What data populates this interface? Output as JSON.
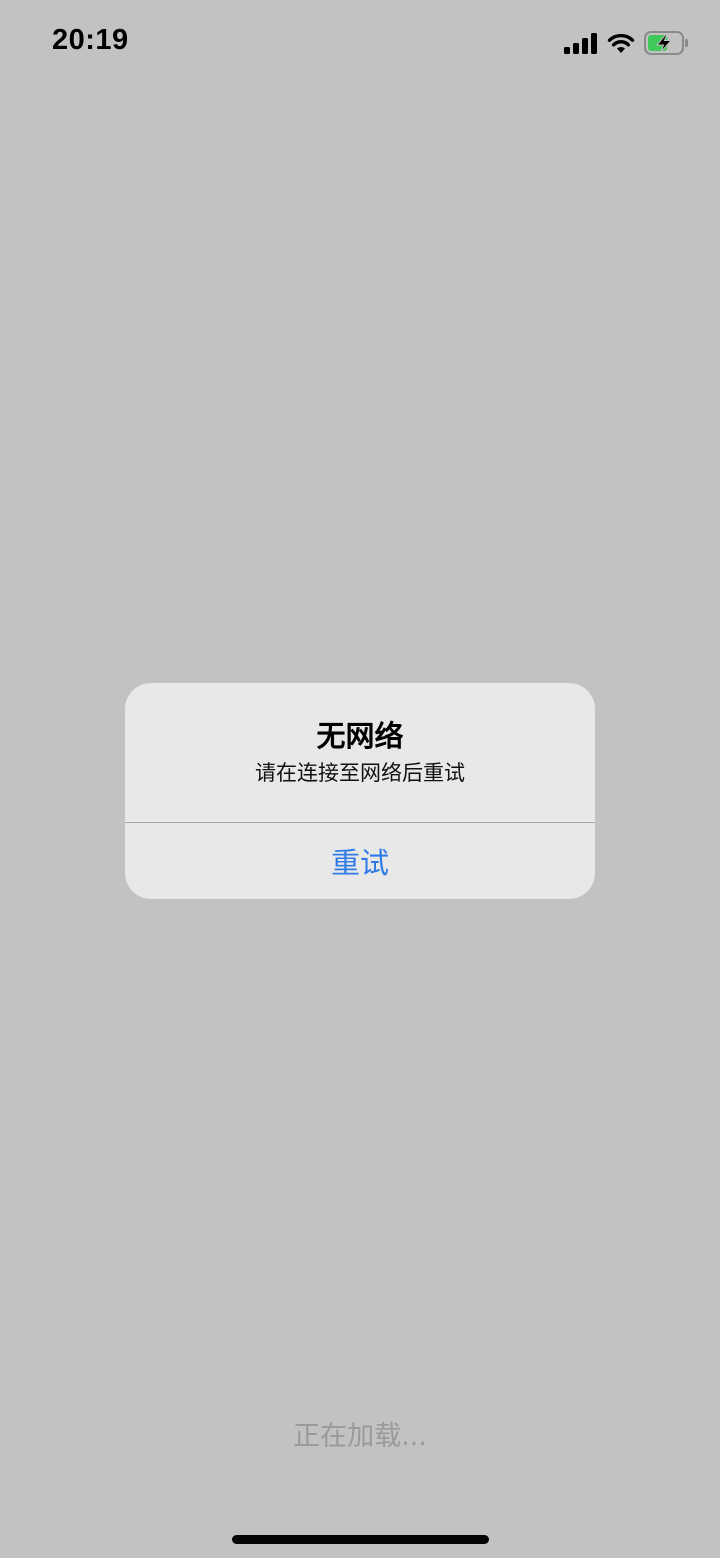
{
  "status_bar": {
    "time": "20:19",
    "icons": [
      "signal-icon",
      "wifi-icon",
      "battery-charging-icon"
    ],
    "battery_level": 0.6,
    "battery_color": "#3fc95a"
  },
  "alert": {
    "title": "无网络",
    "message": "请在连接至网络后重试",
    "button_label": "重试",
    "button_color": "#2f7ce6"
  },
  "loading": {
    "text": "正在加载..."
  }
}
